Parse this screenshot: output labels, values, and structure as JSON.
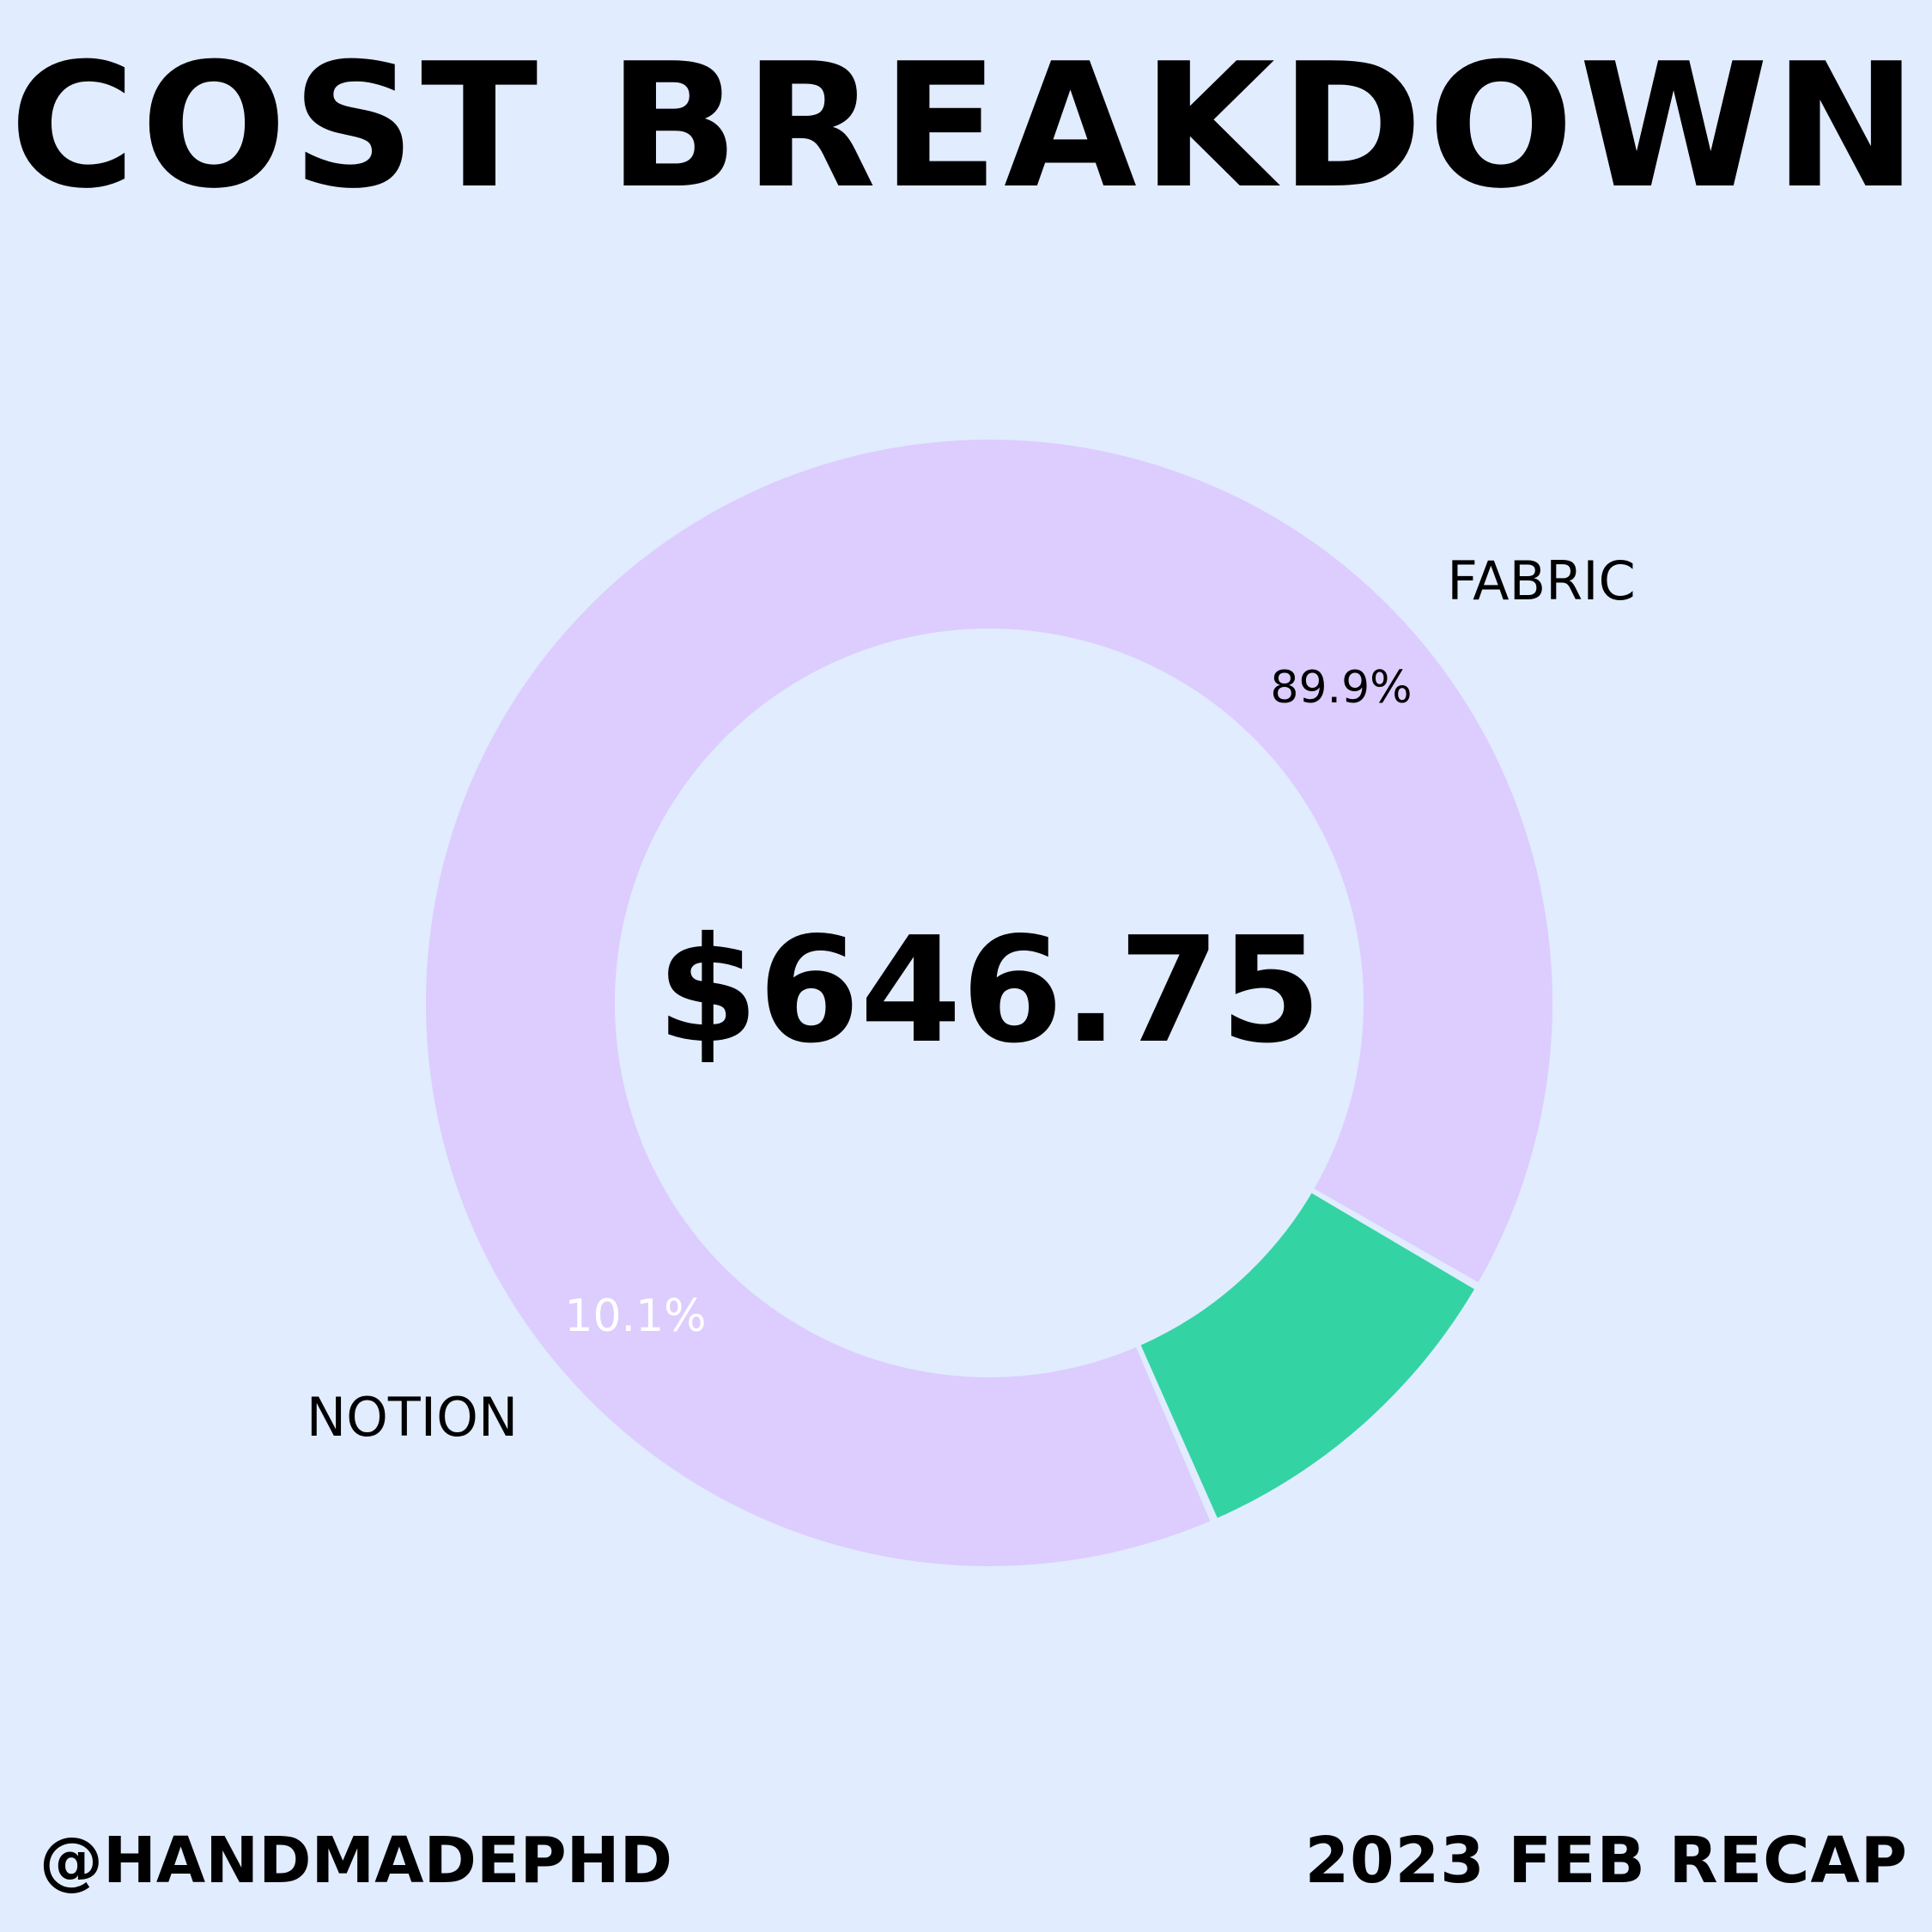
{
  "title": "COST BREAKDOWN",
  "footer": {
    "handle": "@HANDMADEPHD",
    "period": "2023 FEB RECAP"
  },
  "chart_data": {
    "type": "pie",
    "subtype": "donut",
    "center_label": "$646.75",
    "categories": [
      "FABRIC",
      "NOTION"
    ],
    "values": [
      89.9,
      10.1
    ],
    "value_labels": [
      "89.9%",
      "10.1%"
    ],
    "colors": [
      "#dccdfe",
      "#34d3a3"
    ],
    "value_label_colors": [
      "#000000",
      "#ffffff"
    ]
  }
}
